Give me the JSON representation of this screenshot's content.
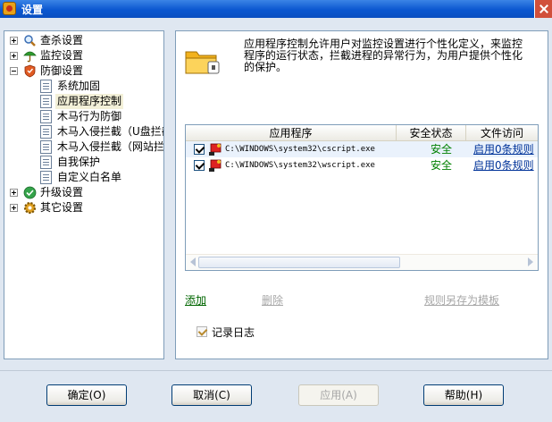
{
  "window": {
    "title": "设置"
  },
  "tree": {
    "items": [
      {
        "label": "查杀设置",
        "icon": "magnifier-icon",
        "expander": "plus"
      },
      {
        "label": "监控设置",
        "icon": "umbrella-icon",
        "expander": "plus"
      },
      {
        "label": "防御设置",
        "icon": "shield-icon",
        "expander": "minus"
      },
      {
        "label": "系统加固"
      },
      {
        "label": "应用程序控制",
        "selected": true
      },
      {
        "label": "木马行为防御"
      },
      {
        "label": "木马入侵拦截（U盘拦截"
      },
      {
        "label": "木马入侵拦截（网站拦"
      },
      {
        "label": "自我保护"
      },
      {
        "label": "自定义白名单"
      },
      {
        "label": "升级设置",
        "icon": "check-circle-icon",
        "expander": "plus"
      },
      {
        "label": "其它设置",
        "icon": "gear-icon",
        "expander": "plus"
      }
    ]
  },
  "panel": {
    "description": "应用程序控制允许用户对监控设置进行个性化定义，来监控程序的运行状态，拦截进程的异常行为，为用户提供个性化的保护。",
    "columns": [
      "应用程序",
      "安全状态",
      "文件访问"
    ],
    "rows": [
      {
        "path": "C:\\WINDOWS\\system32\\cscript.exe",
        "status": "安全",
        "rule": "启用0条规则",
        "checked": true
      },
      {
        "path": "C:\\WINDOWS\\system32\\wscript.exe",
        "status": "安全",
        "rule": "启用0条规则",
        "checked": true
      }
    ],
    "actions": {
      "add": "添加",
      "delete": "删除",
      "save_template": "规则另存为模板"
    },
    "log_label": "记录日志",
    "log_checked": true
  },
  "buttons": {
    "ok": "确定(O)",
    "cancel": "取消(C)",
    "apply": "应用(A)",
    "help": "帮助(H)"
  },
  "colors": {
    "titlebar": "#0b57d0",
    "safe": "#008000",
    "link": "#003399",
    "add": "#006600"
  }
}
